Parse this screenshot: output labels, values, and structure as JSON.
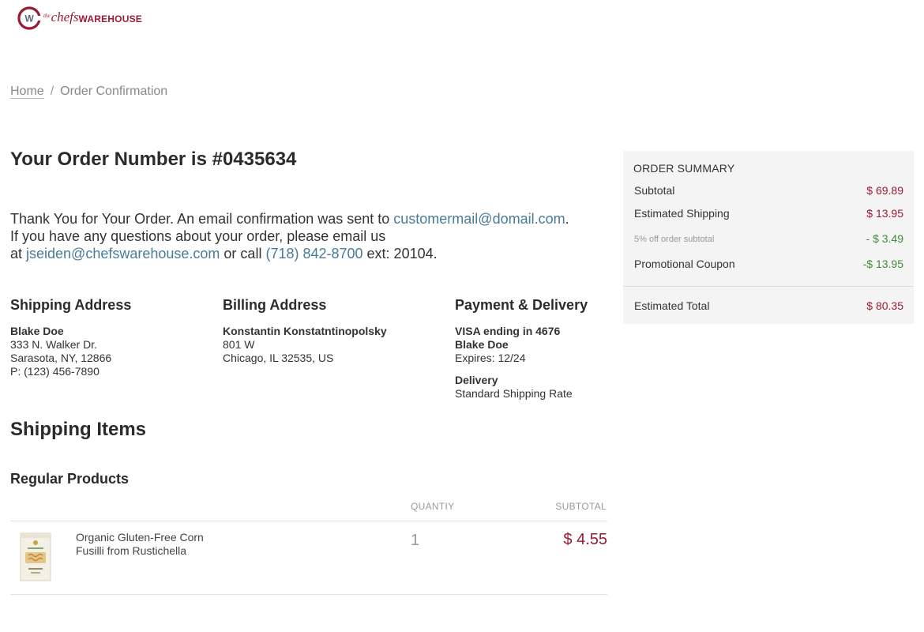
{
  "brand": {
    "the": "the",
    "chefs": "chefs",
    "warehouse": "WAREHOUSE",
    "mark_letter": "W",
    "color": "#9b1a33"
  },
  "breadcrumb": {
    "home": "Home",
    "separator": "/",
    "current": "Order Confirmation"
  },
  "order": {
    "title": "Your Order Number is #0435634",
    "thanks_line1": "Thank You for Your Order. An email confirmation was sent to ",
    "customer_email": "customermail@domail.com",
    "period": ".",
    "thanks_line2": "If you have any questions about your order, please email us",
    "at": "at ",
    "contact_email": "jseiden@chefswarehouse.com",
    "or_call": " or call ",
    "phone": "(718) 842-8700",
    "ext": " ext: 20104."
  },
  "shipping_address": {
    "heading": "Shipping Address",
    "name": "Blake Doe",
    "line1": "333 N. Walker Dr.",
    "line2": "Sarasota, NY, 12866",
    "phone": "P: (123) 456-7890"
  },
  "billing_address": {
    "heading": "Billing Address",
    "name": "Konstantin Konstatntinopolsky",
    "line1": "801 W",
    "line2": "Chicago, IL 32535, US"
  },
  "payment": {
    "heading": "Payment & Delivery",
    "card": "VISA ending in 4676",
    "name": "Blake Doe",
    "expires": "Expires: 12/24",
    "delivery_label": "Delivery",
    "delivery_value": "Standard Shipping Rate"
  },
  "items": {
    "section_title": "Shipping Items",
    "group_title": "Regular Products",
    "col_quantity": "QUANTIY",
    "col_subtotal": "SUBTOTAL",
    "rows": [
      {
        "name": "Organic Gluten-Free Corn Fusilli from Rustichella",
        "quantity": "1",
        "subtotal": "$ 4.55"
      }
    ]
  },
  "summary": {
    "heading": "ORDER SUMMARY",
    "subtotal_label": "Subtotal",
    "subtotal_value": "$ 69.89",
    "shipping_label": "Estimated Shipping",
    "shipping_value": "$ 13.95",
    "discount_label": "5% off order subtotal",
    "discount_value": "- $ 3.49",
    "coupon_label": "Promotional Coupon",
    "coupon_value": "-$ 13.95",
    "total_label": "Estimated Total",
    "total_value": "$ 80.35"
  }
}
